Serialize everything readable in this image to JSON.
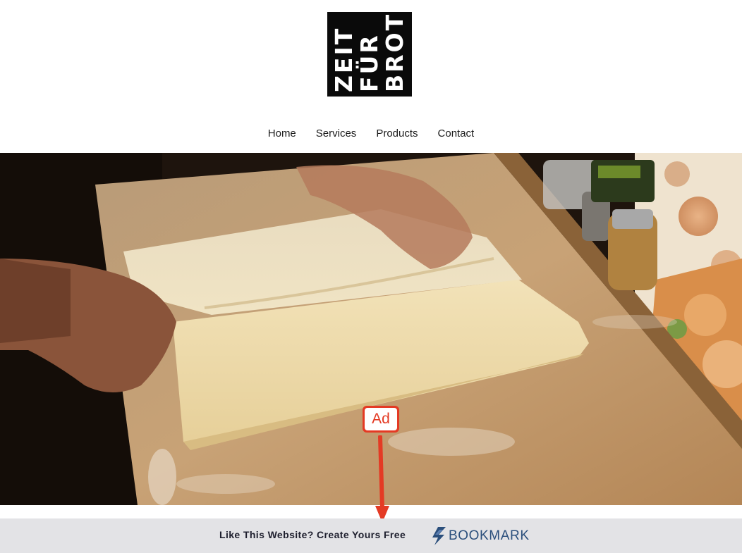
{
  "logo": {
    "lines": [
      "ZEIT",
      "FÜR",
      "BROT"
    ]
  },
  "nav": {
    "items": [
      "Home",
      "Services",
      "Products",
      "Contact"
    ]
  },
  "hero": {
    "image": "dough-folding-photo"
  },
  "annotation": {
    "label": "Ad",
    "color": "#e43a24"
  },
  "banner": {
    "text": "Like This Website? Create Yours Free",
    "brand": "BOOKMARK",
    "brand_color": "#2b4f7c",
    "background": "#e3e3e6"
  }
}
